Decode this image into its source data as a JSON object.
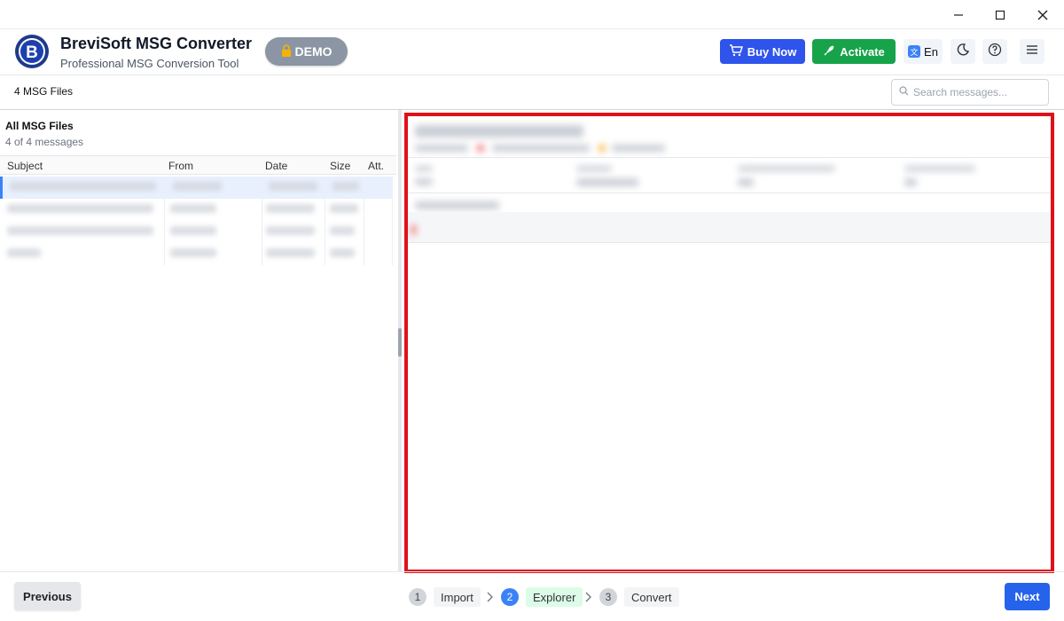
{
  "window": {
    "controls": [
      "minimize-icon",
      "maximize-icon",
      "close-icon"
    ]
  },
  "header": {
    "title": "BreviSoft MSG Converter",
    "subtitle": "Professional MSG Conversion Tool",
    "demo_badge": "DEMO",
    "buy_now": "Buy Now",
    "activate": "Activate",
    "lang": "En",
    "icons": [
      "cart-icon",
      "rocket-icon",
      "translate-icon",
      "moon-icon",
      "help-icon",
      "menu-icon"
    ]
  },
  "toolbar": {
    "file_count": "4 MSG Files",
    "search_placeholder": "Search messages..."
  },
  "list": {
    "title": "All MSG Files",
    "count": "4 of 4 messages",
    "columns": [
      "Subject",
      "From",
      "Date",
      "Size",
      "Att."
    ],
    "rows": [
      {
        "selected": true
      },
      {
        "selected": false
      },
      {
        "selected": false
      },
      {
        "selected": false
      }
    ]
  },
  "footer": {
    "previous": "Previous",
    "next": "Next",
    "steps": [
      {
        "num": "1",
        "label": "Import",
        "active": false
      },
      {
        "num": "2",
        "label": "Explorer",
        "active": true
      },
      {
        "num": "3",
        "label": "Convert",
        "active": false
      }
    ]
  },
  "colors": {
    "primary": "#2f54eb",
    "success": "#16a34a",
    "highlight_border": "#e0101a",
    "selected_row": "#e8f0fe"
  }
}
